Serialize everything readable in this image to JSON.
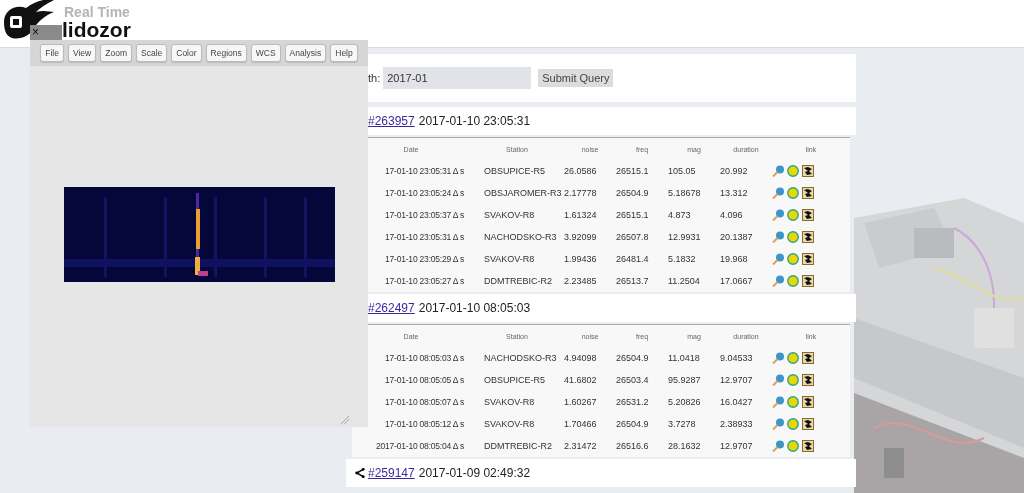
{
  "header": {
    "subtitle": "Real Time",
    "brand": "lidozor"
  },
  "form": {
    "label": "th:",
    "value": "2017-01",
    "submit": "Submit Query"
  },
  "events": [
    {
      "id": "#263957",
      "time": "2017-01-10 23:05:31",
      "columns": [
        "Date",
        "Station",
        "noise",
        "freq",
        "mag",
        "duration",
        "link"
      ],
      "rows": [
        {
          "date": "17-01-10 23:05:31 Δ s",
          "station": "OBSUPICE-R5",
          "noise": "26.0586",
          "freq": "26515.1",
          "mag": "105.05",
          "duration": "20.992"
        },
        {
          "date": "17-01-10 23:05:24 Δ s",
          "station": "OBSJAROMER-R3",
          "noise": "2.17778",
          "freq": "26504.9",
          "mag": "5.18678",
          "duration": "13.312"
        },
        {
          "date": "17-01-10 23:05:37 Δ s",
          "station": "SVAKOV-R8",
          "noise": "1.61324",
          "freq": "26515.1",
          "mag": "4.873",
          "duration": "4.096"
        },
        {
          "date": "17-01-10 23:05:31 Δ s",
          "station": "NACHODSKO-R3",
          "noise": "3.92099",
          "freq": "26507.8",
          "mag": "12.9931",
          "duration": "20.1387"
        },
        {
          "date": "17-01-10 23:05:29 Δ s",
          "station": "SVAKOV-R8",
          "noise": "1.99436",
          "freq": "26481.4",
          "mag": "5.1832",
          "duration": "19.968"
        },
        {
          "date": "17-01-10 23:05:27 Δ s",
          "station": "DDMTREBIC-R2",
          "noise": "2.23485",
          "freq": "26513.7",
          "mag": "11.2504",
          "duration": "17.0667"
        }
      ]
    },
    {
      "id": "#262497",
      "time": "2017-01-10 08:05:03",
      "columns": [
        "Date",
        "Station",
        "noise",
        "freq",
        "mag",
        "duration",
        "link"
      ],
      "rows": [
        {
          "date": "17-01-10 08:05:03 Δ s",
          "station": "NACHODSKO-R3",
          "noise": "4.94098",
          "freq": "26504.9",
          "mag": "11.0418",
          "duration": "9.04533"
        },
        {
          "date": "17-01-10 08:05:05 Δ s",
          "station": "OBSUPICE-R5",
          "noise": "41.6802",
          "freq": "26503.4",
          "mag": "95.9287",
          "duration": "12.9707"
        },
        {
          "date": "17-01-10 08:05:07 Δ s",
          "station": "SVAKOV-R8",
          "noise": "1.60267",
          "freq": "26531.2",
          "mag": "5.20826",
          "duration": "16.0427"
        },
        {
          "date": "17-01-10 08:05:12 Δ s",
          "station": "SVAKOV-R8",
          "noise": "1.70466",
          "freq": "26504.9",
          "mag": "3.7278",
          "duration": "2.38933"
        },
        {
          "date": "2017-01-10 08:05:04 Δ s",
          "station": "DDMTREBIC-R2",
          "noise": "2.31472",
          "freq": "26516.6",
          "mag": "28.1632",
          "duration": "12.9707"
        }
      ]
    },
    {
      "share": true,
      "id": "#259147",
      "time": "2017-01-09 02:49:32"
    }
  ],
  "viewer": {
    "close": "×",
    "menu": [
      "File",
      "View",
      "Zoom",
      "Scale",
      "Color",
      "Regions",
      "WCS",
      "Analysis",
      "Help"
    ]
  }
}
